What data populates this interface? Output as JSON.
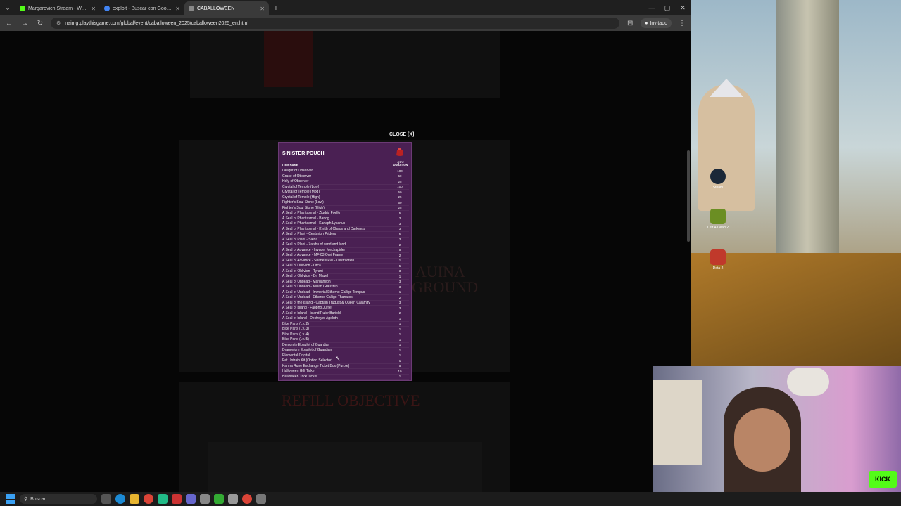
{
  "browser": {
    "tabs": [
      {
        "title": "Margarovich Stream - Watch Li",
        "color": "#53fc18",
        "active": false
      },
      {
        "title": "exploit - Buscar con Google",
        "color": "#4285f4",
        "active": false
      },
      {
        "title": "CABALLOWEEN",
        "color": "#888888",
        "active": true
      }
    ],
    "url": "naimg.playthisgame.com/global/event/caballoween_2025/caballoween2025_en.html",
    "profile_label": "Invitado"
  },
  "modal": {
    "close_label": "CLOSE [X]",
    "title": "SINISTER POUCH",
    "col_item": "ITEM NAME",
    "col_qty_1": "QTY/",
    "col_qty_2": "DURATION",
    "items": [
      {
        "name": "Delight of Observer",
        "qty": "100"
      },
      {
        "name": "Grace of Observer",
        "qty": "50"
      },
      {
        "name": "Holy of Observer",
        "qty": "25"
      },
      {
        "name": "Crystal of Temple (Low)",
        "qty": "100"
      },
      {
        "name": "Crystal of Temple (Mod)",
        "qty": "50"
      },
      {
        "name": "Crystal of Temple (High)",
        "qty": "25"
      },
      {
        "name": "Fighter's Soul Stone (Low)",
        "qty": "50"
      },
      {
        "name": "Fighter's Soul Stone (High)",
        "qty": "25"
      },
      {
        "name": "A Seal of Phantasmal - Zigdris Foello",
        "qty": "5"
      },
      {
        "name": "A Seal of Phantasmal - Barlog",
        "qty": "3"
      },
      {
        "name": "A Seal of Phantasmal - Kanaph Lycanus",
        "qty": "3"
      },
      {
        "name": "A Seal of Phantasmal - K'nith of Chaos and Darkness",
        "qty": "3"
      },
      {
        "name": "A Seal of Plant - Centurion Prideus",
        "qty": "5"
      },
      {
        "name": "A Seal of Plant - Siena",
        "qty": "3"
      },
      {
        "name": "A Seal of Plant - Zalshu of wind and land",
        "qty": "2"
      },
      {
        "name": "A Seal of Advance - Invader Mechapider",
        "qty": "5"
      },
      {
        "name": "A Seal of Advance - MF-03 Orei Frame",
        "qty": "2"
      },
      {
        "name": "A Seal of Advance - Shane's Evil - Destruction",
        "qty": "1"
      },
      {
        "name": "A Seal of Oblivion - Orca",
        "qty": "5"
      },
      {
        "name": "A Seal of Oblivion - Tyrant",
        "qty": "3"
      },
      {
        "name": "A Seal of Oblivion - Dr. Mazel",
        "qty": "1"
      },
      {
        "name": "A Seal of Undead - Margaheph",
        "qty": "3"
      },
      {
        "name": "A Seal of Undead - Killian Grausten",
        "qty": "3"
      },
      {
        "name": "A Seal of Undead - Immortal Etherno Calligo Tempus",
        "qty": "1"
      },
      {
        "name": "A Seal of Undead - Etherno Calligo Thanatos",
        "qty": "2"
      },
      {
        "name": "A Seal of the Island - Captain Trugust & Queen Calamity",
        "qty": "3"
      },
      {
        "name": "A Seal of Island - Faobho Jurife",
        "qty": "3"
      },
      {
        "name": "A Seal of Island - Island Ruler Bariold",
        "qty": "2"
      },
      {
        "name": "A Seal of Island - Destroyer Ageluth",
        "qty": "1"
      },
      {
        "name": "Bike Parts (Lv. 2)",
        "qty": "1"
      },
      {
        "name": "Bike Parts (Lv. 3)",
        "qty": "1"
      },
      {
        "name": "Bike Parts (Lv. 4)",
        "qty": "1"
      },
      {
        "name": "Bike Parts (Lv. 5)",
        "qty": "1"
      },
      {
        "name": "Demonite Epaulet of Guardian",
        "qty": "1"
      },
      {
        "name": "Dragonium Epaulet of Guardian",
        "qty": "1"
      },
      {
        "name": "Elemental Crystal",
        "qty": "1"
      },
      {
        "name": "Pet Untrain Kit (Option Selector)",
        "qty": "1"
      },
      {
        "name": "Karma Rune Exchange Ticket Box (Purple)",
        "qty": "5"
      },
      {
        "name": "Halloween Gift Ticket",
        "qty": "10"
      },
      {
        "name": "Halloween Trick Ticket",
        "qty": "1"
      }
    ]
  },
  "background_page": {
    "refill_title": "REFILL OBJECTIVE",
    "faint_title_line1": "AUINA",
    "faint_title_line2": "GROUND"
  },
  "desktop": {
    "icons": [
      {
        "label": "Steam",
        "color": "#1b2838"
      },
      {
        "label": "Left 4 Dead 2",
        "color": "#6b8e23"
      },
      {
        "label": "Dota 2",
        "color": "#c0392b"
      }
    ]
  },
  "webcam": {
    "brand": "KICK"
  },
  "taskbar": {
    "search_label": "Buscar"
  }
}
